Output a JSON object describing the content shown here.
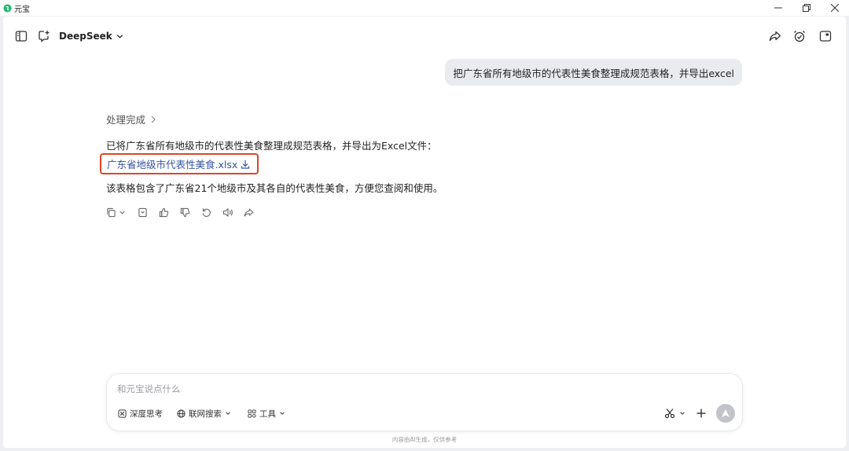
{
  "window": {
    "title": "元宝",
    "controls": [
      "minimize-icon",
      "restore-icon",
      "close-icon"
    ]
  },
  "topbar": {
    "model_name": "DeepSeek",
    "left_icons": [
      "sidebar-toggle-icon",
      "new-chat-icon"
    ],
    "right_icons": [
      "share-icon",
      "alarm-icon",
      "window-icon"
    ]
  },
  "conversation": {
    "user_message": "把广东省所有地级市的代表性美食整理成规范表格，并导出excel",
    "status": "处理完成",
    "answer_line1": "已将广东省所有地级市的代表性美食整理成规范表格，并导出为Excel文件：",
    "file_name": "广东省地级市代表性美食.xlsx",
    "answer_line2": "该表格包含了广东省21个地级市及其各自的代表性美食，方便您查阅和使用。",
    "action_icons": [
      "copy-icon",
      "chevron-down-icon",
      "bookmark-icon",
      "thumbs-up-icon",
      "thumbs-down-icon",
      "regenerate-icon",
      "speaker-icon",
      "share-icon"
    ]
  },
  "input": {
    "placeholder": "和元宝说点什么",
    "value": "",
    "deep_think": "深度思考",
    "web_search": "联网搜索",
    "tools": "工具"
  },
  "footer": {
    "disclaimer": "内容由AI生成，仅供参考"
  },
  "colors": {
    "link": "#3553a6",
    "highlight_border": "#d9482b",
    "bubble": "#eaebee",
    "send_button": "#c2c4c9"
  }
}
